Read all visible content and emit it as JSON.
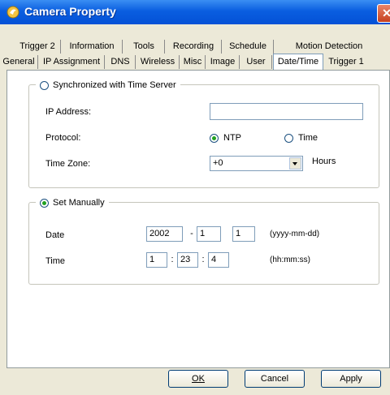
{
  "window": {
    "title": "Camera Property",
    "close_glyph": "✕",
    "icon": "camera-property-icon"
  },
  "tabs_row1": [
    "Trigger 2",
    "Information",
    "Tools",
    "Recording",
    "Schedule",
    "Motion Detection"
  ],
  "tabs_row2": [
    "General",
    "IP Assignment",
    "DNS",
    "Wireless",
    "Misc",
    "Image",
    "User",
    "Date/Time",
    "Trigger 1"
  ],
  "active_tab": "Date/Time",
  "sync_group": {
    "legend": "Synchronized with Time Server",
    "selected": false,
    "ip_label": "IP Address:",
    "ip_value": "",
    "protocol_label": "Protocol:",
    "protocol_ntp": "NTP",
    "protocol_time": "Time",
    "protocol_selected": "NTP",
    "timezone_label": "Time Zone:",
    "timezone_value": "+0",
    "hours_label": "Hours"
  },
  "manual_group": {
    "legend": "Set Manually",
    "selected": true,
    "date_label": "Date",
    "date_year": "2002",
    "date_month": "1",
    "date_day": "1",
    "date_sep": "-",
    "date_format": "(yyyy-mm-dd)",
    "time_label": "Time",
    "time_hour": "1",
    "time_minute": "23",
    "time_second": "4",
    "time_sep": ":",
    "time_format": "(hh:mm:ss)"
  },
  "buttons": {
    "ok": "OK",
    "cancel": "Cancel",
    "apply": "Apply"
  },
  "colors": {
    "titlebar": "#0a5ee0",
    "radio_dot": "#21a121",
    "panel": "#ffffff",
    "dialog_bg": "#ece9d8"
  }
}
